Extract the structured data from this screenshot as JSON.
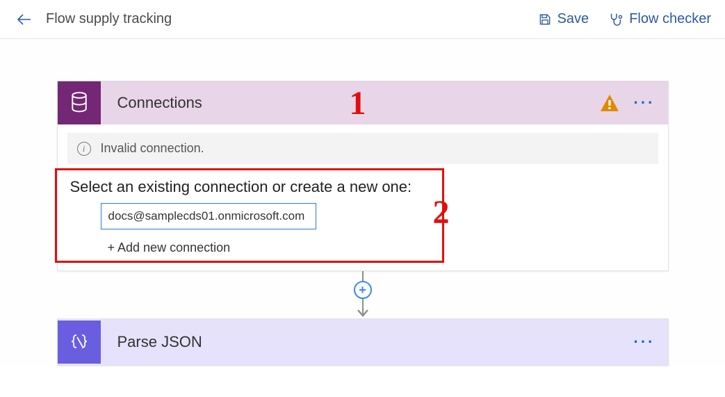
{
  "topbar": {
    "title": "Flow supply tracking",
    "save_label": "Save",
    "flow_checker_label": "Flow checker"
  },
  "connections_card": {
    "title": "Connections",
    "banner_text": "Invalid connection.",
    "prompt": "Select an existing connection or create a new one:",
    "selected_connection": "docs@samplecds01.onmicrosoft.com",
    "add_new_label": "+ Add new connection"
  },
  "json_card": {
    "title": "Parse JSON"
  },
  "annotations": {
    "num1": "1",
    "num2": "2"
  }
}
